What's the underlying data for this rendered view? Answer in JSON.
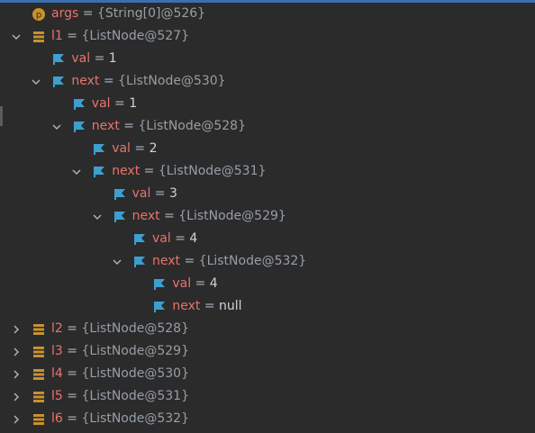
{
  "colors": {
    "background": "#2b2b2b",
    "variable_name": "#e8746e",
    "type_ref": "#979ea6",
    "primitive_value": "#d0d4d8",
    "field_icon": "#3d9fd0",
    "local_icon": "#c8922d",
    "param_icon": "#c8922d"
  },
  "rows": [
    {
      "indent": 0,
      "arrow": "none",
      "icon": "param-icon",
      "name": "args",
      "eq": " = ",
      "value": "{String[0]@526}",
      "kind": "ref"
    },
    {
      "indent": 0,
      "arrow": "down",
      "icon": "local-variable-icon",
      "name": "l1",
      "eq": " = ",
      "value": "{ListNode@527}",
      "kind": "ref"
    },
    {
      "indent": 1,
      "arrow": "none",
      "icon": "field-icon",
      "name": "val",
      "eq": " = ",
      "value": "1",
      "kind": "prim"
    },
    {
      "indent": 1,
      "arrow": "down",
      "icon": "field-icon",
      "name": "next",
      "eq": " = ",
      "value": "{ListNode@530}",
      "kind": "ref"
    },
    {
      "indent": 2,
      "arrow": "none",
      "icon": "field-icon",
      "name": "val",
      "eq": " = ",
      "value": "1",
      "kind": "prim"
    },
    {
      "indent": 2,
      "arrow": "down",
      "icon": "field-icon",
      "name": "next",
      "eq": " = ",
      "value": "{ListNode@528}",
      "kind": "ref"
    },
    {
      "indent": 3,
      "arrow": "none",
      "icon": "field-icon",
      "name": "val",
      "eq": " = ",
      "value": "2",
      "kind": "prim"
    },
    {
      "indent": 3,
      "arrow": "down",
      "icon": "field-icon",
      "name": "next",
      "eq": " = ",
      "value": "{ListNode@531}",
      "kind": "ref"
    },
    {
      "indent": 4,
      "arrow": "none",
      "icon": "field-icon",
      "name": "val",
      "eq": " = ",
      "value": "3",
      "kind": "prim"
    },
    {
      "indent": 4,
      "arrow": "down",
      "icon": "field-icon",
      "name": "next",
      "eq": " = ",
      "value": "{ListNode@529}",
      "kind": "ref"
    },
    {
      "indent": 5,
      "arrow": "none",
      "icon": "field-icon",
      "name": "val",
      "eq": " = ",
      "value": "4",
      "kind": "prim"
    },
    {
      "indent": 5,
      "arrow": "down",
      "icon": "field-icon",
      "name": "next",
      "eq": " = ",
      "value": "{ListNode@532}",
      "kind": "ref"
    },
    {
      "indent": 6,
      "arrow": "none",
      "icon": "field-icon",
      "name": "val",
      "eq": " = ",
      "value": "4",
      "kind": "prim"
    },
    {
      "indent": 6,
      "arrow": "none",
      "icon": "field-icon",
      "name": "next",
      "eq": " = ",
      "value": "null",
      "kind": "prim"
    },
    {
      "indent": 0,
      "arrow": "right",
      "icon": "local-variable-icon",
      "name": "l2",
      "eq": " = ",
      "value": "{ListNode@528}",
      "kind": "ref"
    },
    {
      "indent": 0,
      "arrow": "right",
      "icon": "local-variable-icon",
      "name": "l3",
      "eq": " = ",
      "value": "{ListNode@529}",
      "kind": "ref"
    },
    {
      "indent": 0,
      "arrow": "right",
      "icon": "local-variable-icon",
      "name": "l4",
      "eq": " = ",
      "value": "{ListNode@530}",
      "kind": "ref"
    },
    {
      "indent": 0,
      "arrow": "right",
      "icon": "local-variable-icon",
      "name": "l5",
      "eq": " = ",
      "value": "{ListNode@531}",
      "kind": "ref"
    },
    {
      "indent": 0,
      "arrow": "right",
      "icon": "local-variable-icon",
      "name": "l6",
      "eq": " = ",
      "value": "{ListNode@532}",
      "kind": "ref"
    }
  ]
}
